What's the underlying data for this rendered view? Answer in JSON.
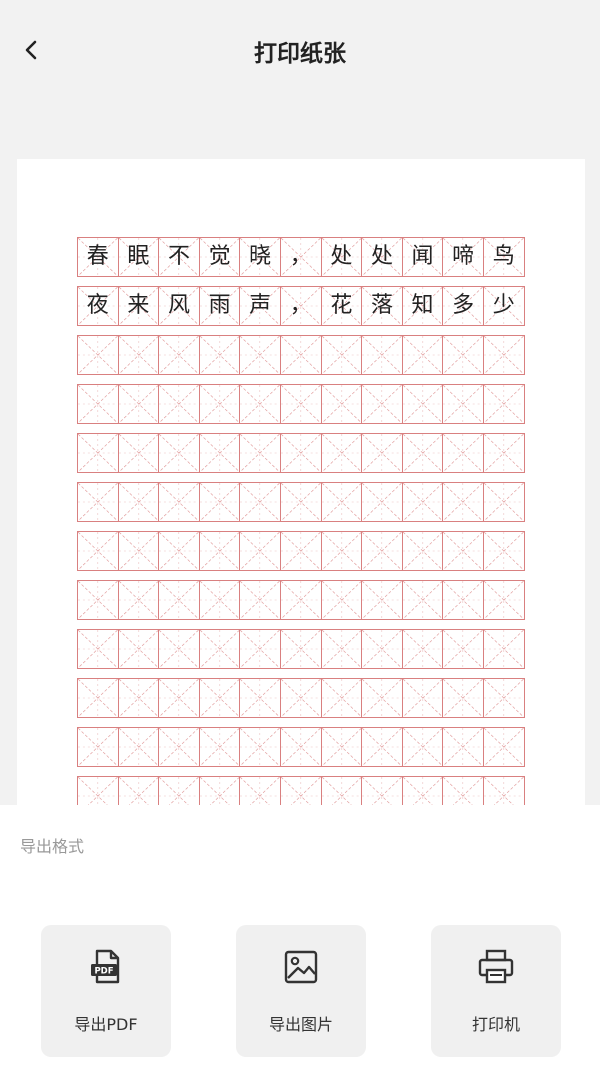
{
  "header": {
    "title": "打印纸张"
  },
  "paper": {
    "rows": [
      [
        "春",
        "眠",
        "不",
        "觉",
        "晓",
        "，",
        "处",
        "处",
        "闻",
        "啼",
        "鸟"
      ],
      [
        "夜",
        "来",
        "风",
        "雨",
        "声",
        "，",
        "花",
        "落",
        "知",
        "多",
        "少"
      ],
      [
        "",
        "",
        "",
        "",
        "",
        "",
        "",
        "",
        "",
        "",
        ""
      ],
      [
        "",
        "",
        "",
        "",
        "",
        "",
        "",
        "",
        "",
        "",
        ""
      ],
      [
        "",
        "",
        "",
        "",
        "",
        "",
        "",
        "",
        "",
        "",
        ""
      ],
      [
        "",
        "",
        "",
        "",
        "",
        "",
        "",
        "",
        "",
        "",
        ""
      ],
      [
        "",
        "",
        "",
        "",
        "",
        "",
        "",
        "",
        "",
        "",
        ""
      ],
      [
        "",
        "",
        "",
        "",
        "",
        "",
        "",
        "",
        "",
        "",
        ""
      ],
      [
        "",
        "",
        "",
        "",
        "",
        "",
        "",
        "",
        "",
        "",
        ""
      ],
      [
        "",
        "",
        "",
        "",
        "",
        "",
        "",
        "",
        "",
        "",
        ""
      ],
      [
        "",
        "",
        "",
        "",
        "",
        "",
        "",
        "",
        "",
        "",
        ""
      ],
      [
        "",
        "",
        "",
        "",
        "",
        "",
        "",
        "",
        "",
        "",
        ""
      ]
    ],
    "grid_color": "#d98080"
  },
  "export": {
    "section_label": "导出格式",
    "buttons": [
      {
        "label": "导出PDF",
        "icon": "pdf-file-icon"
      },
      {
        "label": "导出图片",
        "icon": "image-icon"
      },
      {
        "label": "打印机",
        "icon": "printer-icon"
      }
    ]
  }
}
